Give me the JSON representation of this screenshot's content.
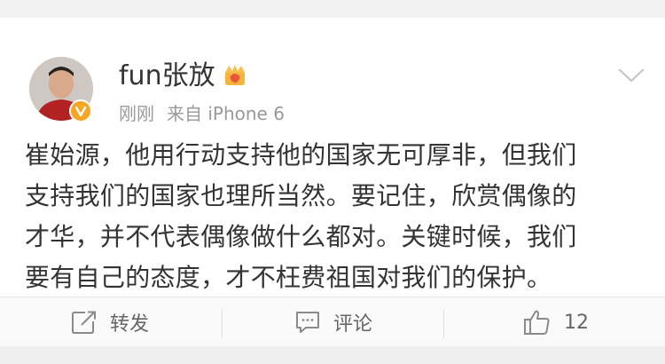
{
  "post": {
    "username": "fun张放",
    "time": "刚刚",
    "source": "来自 iPhone 6",
    "content_lines": [
      "崔始源，他用行动支持他的国家无可厚非，但我们",
      "支持我们的国家也理所当然。要记住，欣赏偶像的",
      "才华，并不代表偶像做什么都对。关键时候，我们",
      "要有自己的态度，才不枉费祖国对我们的保护。"
    ]
  },
  "actions": {
    "repost_label": "转发",
    "comment_label": "评论",
    "like_count": "12"
  },
  "icons": {
    "verified": "verified-v-icon",
    "crown": "crown-icon",
    "menu": "chevron-down-icon",
    "repost": "repost-icon",
    "comment": "comment-icon",
    "like": "thumbs-up-icon"
  },
  "colors": {
    "verified_badge": "#f5a623",
    "text": "#333333",
    "meta_text": "#999999"
  }
}
